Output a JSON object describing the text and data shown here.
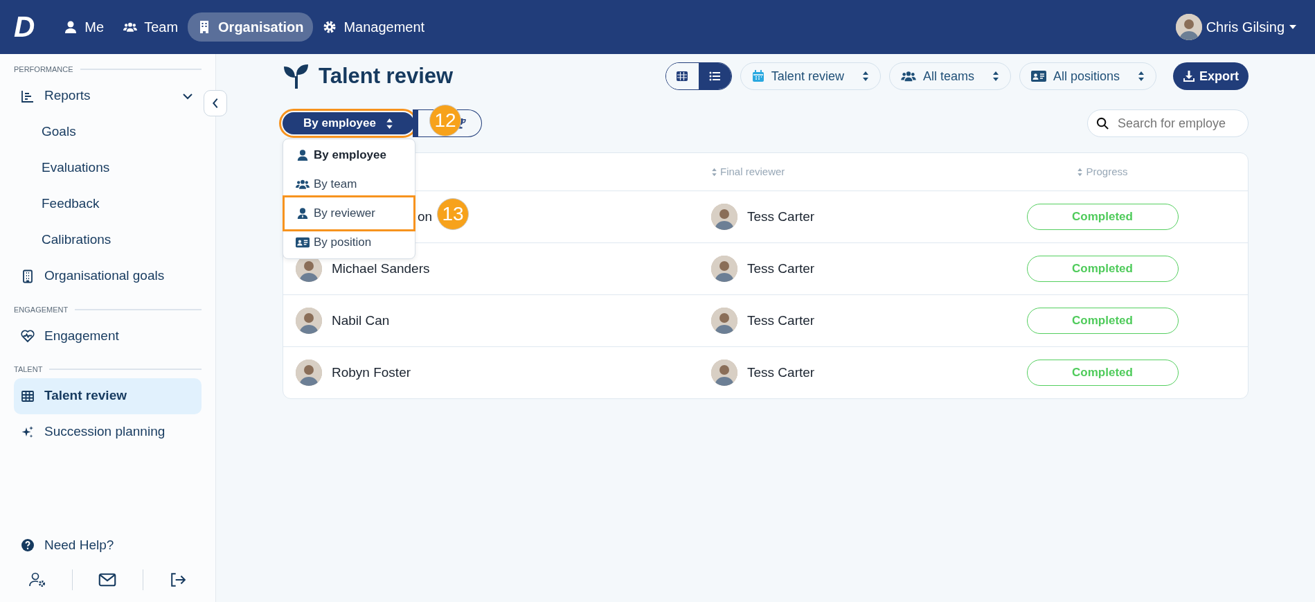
{
  "topbar": {
    "logo": "D",
    "nav": [
      {
        "label": "Me",
        "selected": false
      },
      {
        "label": "Team",
        "selected": false
      },
      {
        "label": "Organisation",
        "selected": true
      },
      {
        "label": "Management",
        "selected": false
      }
    ],
    "user": {
      "name": "Chris Gilsing"
    }
  },
  "sidebar": {
    "sections": [
      {
        "title": "PERFORMANCE",
        "items": [
          {
            "label": "Reports",
            "selected": false,
            "expanded": true,
            "children": [
              {
                "label": "Goals"
              },
              {
                "label": "Evaluations"
              },
              {
                "label": "Feedback"
              },
              {
                "label": "Calibrations"
              }
            ]
          },
          {
            "label": "Organisational goals",
            "selected": false
          }
        ]
      },
      {
        "title": "ENGAGEMENT",
        "items": [
          {
            "label": "Engagement",
            "selected": false
          }
        ]
      },
      {
        "title": "TALENT",
        "items": [
          {
            "label": "Talent review",
            "selected": true
          },
          {
            "label": "Succession planning",
            "selected": false
          }
        ]
      }
    ],
    "help": "Need Help?"
  },
  "page": {
    "title": "Talent review",
    "view_toggle": [
      {
        "selected": false
      },
      {
        "selected": true
      }
    ],
    "filters": [
      {
        "label": "Talent review"
      },
      {
        "label": "All teams"
      },
      {
        "label": "All positions"
      }
    ],
    "export": "Export",
    "group_by": {
      "label": "By employee",
      "callout": "12",
      "options": [
        {
          "label": "By employee",
          "selected": true
        },
        {
          "label": "By team",
          "selected": false
        },
        {
          "label": "By reviewer",
          "selected": false,
          "callout": "13"
        },
        {
          "label": "By position",
          "selected": false
        }
      ]
    },
    "trophy_toggle": {
      "selected": false
    },
    "search": {
      "placeholder": "Search for employe"
    },
    "table": {
      "columns": [
        "Final reviewer",
        "Progress"
      ],
      "rows": [
        {
          "employee": "on",
          "covered": true,
          "reviewer": "Tess Carter",
          "progress": "Completed"
        },
        {
          "employee": "Michael Sanders",
          "covered": false,
          "reviewer": "Tess Carter",
          "progress": "Completed"
        },
        {
          "employee": "Nabil Can",
          "covered": false,
          "reviewer": "Tess Carter",
          "progress": "Completed"
        },
        {
          "employee": "Robyn Foster",
          "covered": false,
          "reviewer": "Tess Carter",
          "progress": "Completed"
        }
      ]
    }
  }
}
